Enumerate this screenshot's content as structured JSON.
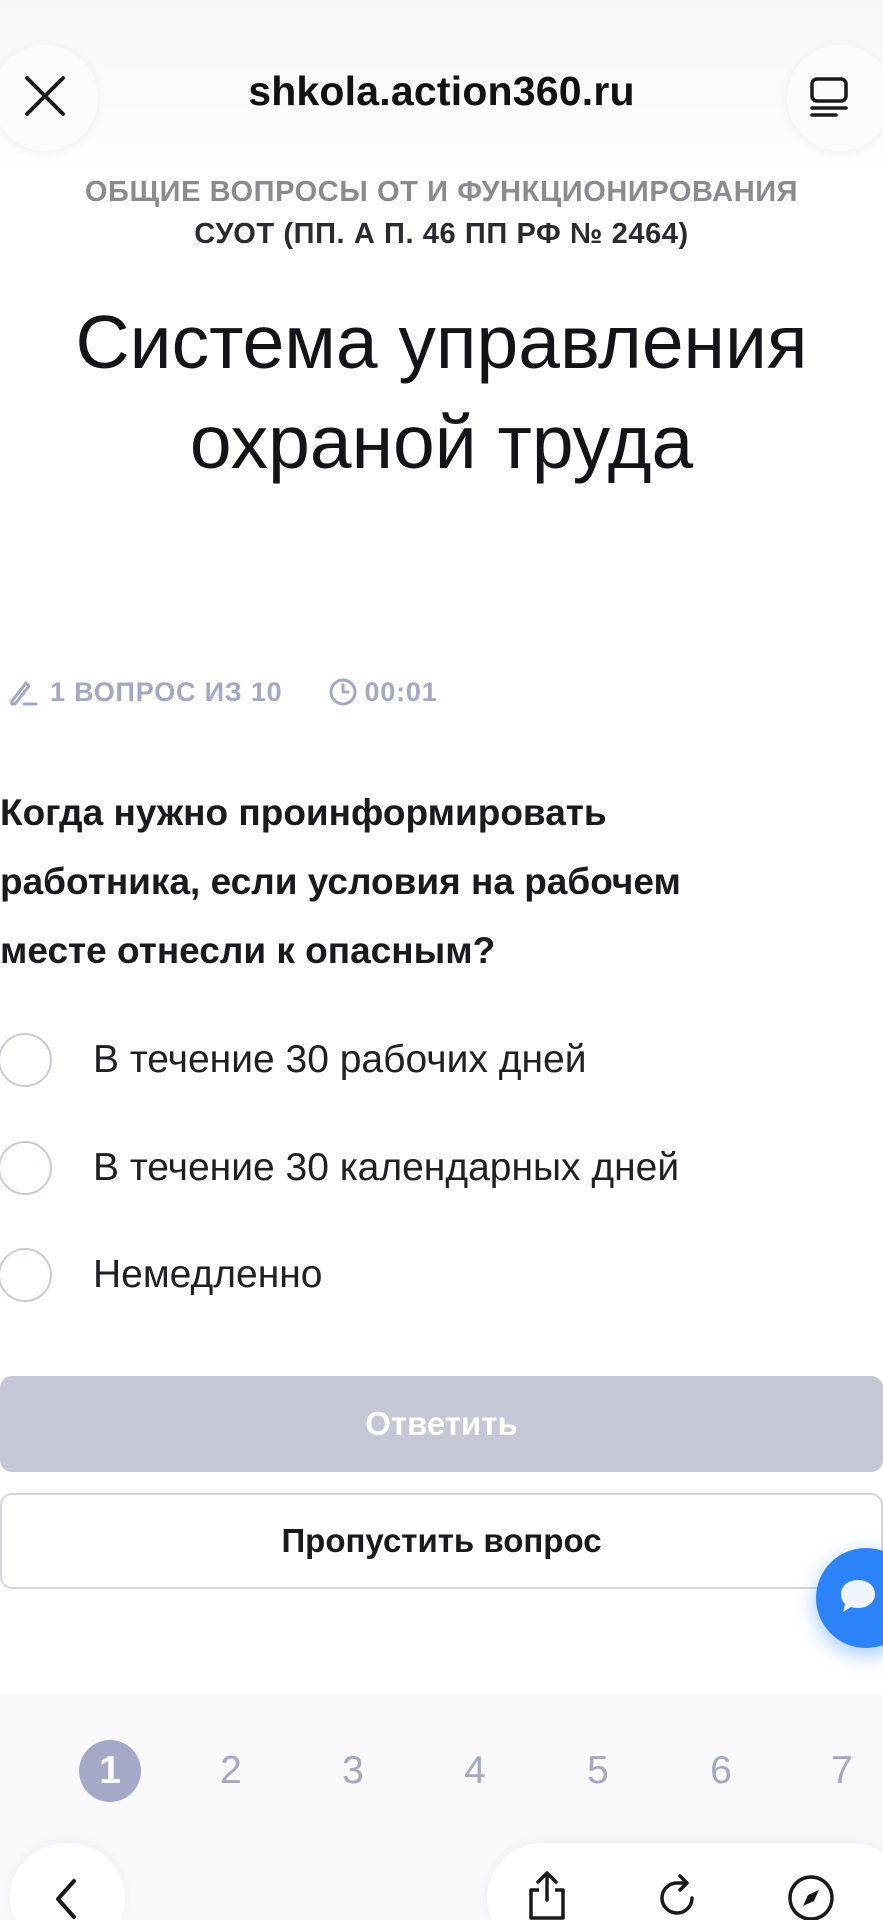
{
  "browser": {
    "url": "shkola.action360.ru",
    "icons": [
      "close-icon",
      "tabs-icon",
      "back-icon",
      "share-icon",
      "reload-icon",
      "compass-icon"
    ]
  },
  "header": {
    "subtitle_line1": "ОБЩИЕ ВОПРОСЫ ОТ И ФУНКЦИОНИРОВАНИЯ",
    "subtitle_line2": "СУОТ (ПП. А П. 46 ПП РФ № 2464)",
    "title_line1": "Система управления",
    "title_line2": "охраной труда"
  },
  "meta": {
    "progress": "1 ВОПРОС ИЗ 10",
    "timer": "00:01"
  },
  "question": {
    "line1": "Когда нужно проинформировать",
    "line2": "работника, если условия на рабочем",
    "line3": "месте отнесли к опасным?",
    "answers": [
      "В течение 30 рабочих дней",
      "В течение 30 календарных дней",
      "Немедленно"
    ]
  },
  "actions": {
    "submit": "Ответить",
    "skip": "Пропустить вопрос"
  },
  "pager": {
    "current": "1",
    "pages": [
      "1",
      "2",
      "3",
      "4",
      "5",
      "6",
      "7"
    ]
  },
  "colors": {
    "accent": "#a4a9c8",
    "disabled_button": "#c4c8d6",
    "chat_button": "#2c83f7"
  }
}
